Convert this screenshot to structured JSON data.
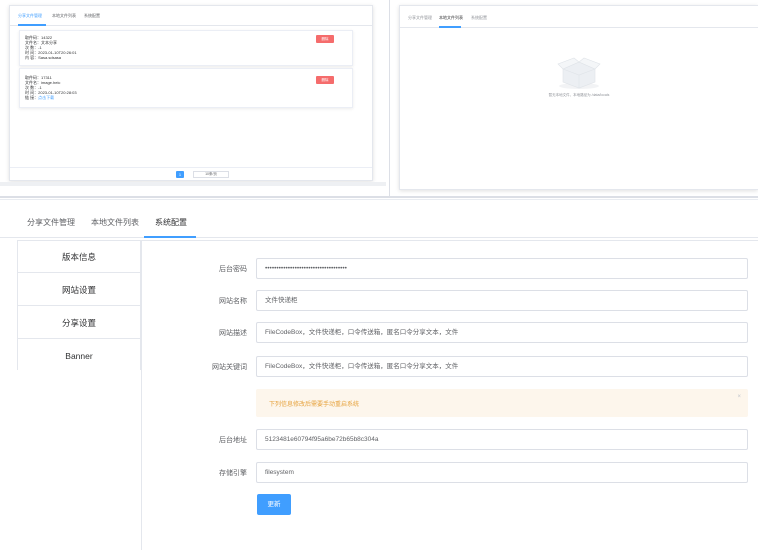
{
  "top_left": {
    "tabs": [
      "分享文件管理",
      "本地文件列表",
      "系统配置"
    ],
    "cards": [
      {
        "lines": [
          {
            "label": "取件码",
            "value": "14322"
          },
          {
            "label": "文件名",
            "value": "文本分享"
          },
          {
            "label": "次 数",
            "value": "-1"
          },
          {
            "label": "时 间",
            "value": "2023-01-10T20:26:01"
          },
          {
            "label": "内 容",
            "value": "Sasa.sdsasa"
          }
        ],
        "delete_label": "删除"
      },
      {
        "lines": [
          {
            "label": "取件码",
            "value": "17311"
          },
          {
            "label": "文件名",
            "value": "image.heic"
          },
          {
            "label": "次 数",
            "value": "-1"
          },
          {
            "label": "时 间",
            "value": "2023-01-10T20:28:03"
          },
          {
            "label": "链 接",
            "value": "点击下载"
          }
        ],
        "delete_label": "删除"
      }
    ],
    "pagination": {
      "current": "1",
      "page_size": "10条/页"
    }
  },
  "top_right": {
    "tabs": [
      "分享文件管理",
      "本地文件列表",
      "系统配置"
    ],
    "empty_text": "暂无本地文件，本地路径为 /data/locals"
  },
  "main": {
    "tabs": [
      "分享文件管理",
      "本地文件列表",
      "系统配置"
    ],
    "active_tab": "系统配置",
    "menu": [
      "版本信息",
      "网站设置",
      "分享设置",
      "Banner"
    ],
    "fields": [
      {
        "label": "后台密码",
        "value": "••••••••••••••••••••••••••••••••••••"
      },
      {
        "label": "网站名称",
        "value": "文件快递柜"
      },
      {
        "label": "网站描述",
        "value": "FileCodeBox，文件快递柜，口令传送箱，匿名口令分享文本，文件"
      },
      {
        "label": "网站关键词",
        "value": "FileCodeBox，文件快递柜，口令传送箱，匿名口令分享文本，文件"
      }
    ],
    "alert": "下列信息修改后需要手动重启系统",
    "fields_after": [
      {
        "label": "后台地址",
        "value": "5123481e60794f95a6be72b65b8c304a"
      },
      {
        "label": "存储引擎",
        "value": "filesystem"
      }
    ],
    "update_label": "更新"
  },
  "colors": {
    "primary": "#409eff",
    "danger": "#f56c6c",
    "warning_bg": "#fdf6ec",
    "warning_text": "#e6a23c"
  }
}
